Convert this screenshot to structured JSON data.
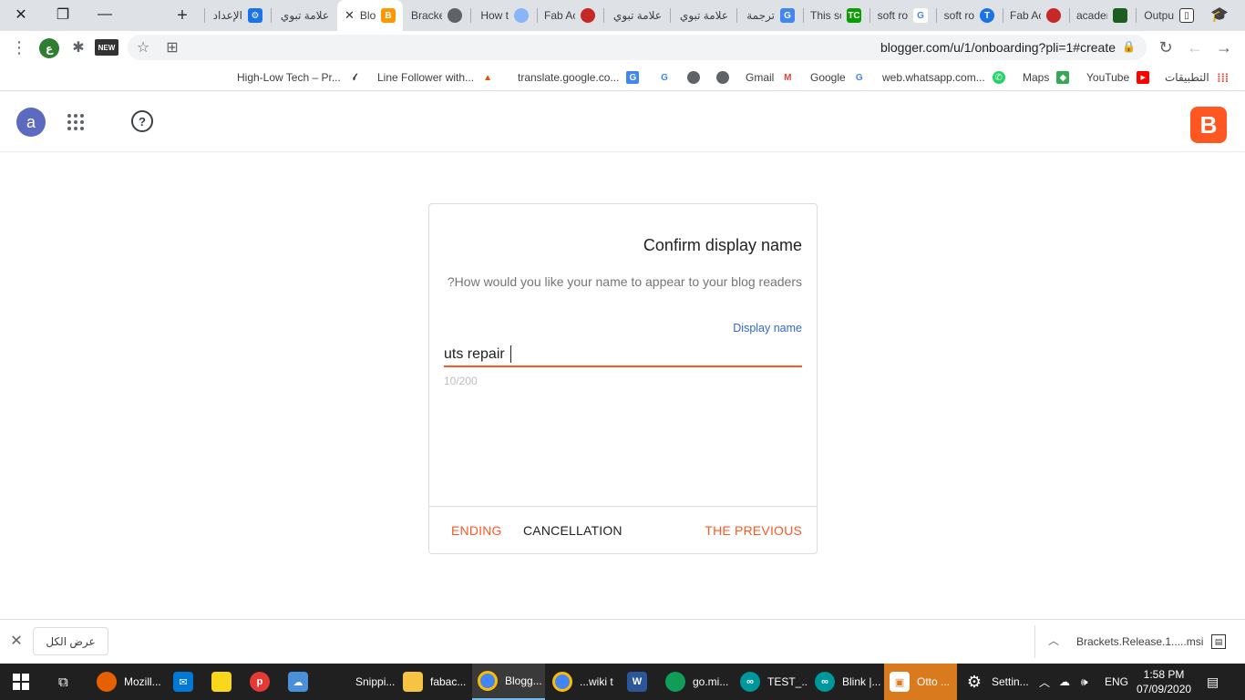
{
  "browser": {
    "tabs": [
      {
        "title": "الإعداد",
        "icon": "gear-icon"
      },
      {
        "title": "علامة تبوي",
        "icon": ""
      },
      {
        "title": "Blo",
        "icon": "blogger-icon",
        "active": true
      },
      {
        "title": "Bracke",
        "icon": "globe-icon"
      },
      {
        "title": "How t",
        "icon": "puzzle-icon"
      },
      {
        "title": "Fab Ac",
        "icon": "fab-icon"
      },
      {
        "title": "علامة تبوي",
        "icon": ""
      },
      {
        "title": "علامة تبوي",
        "icon": ""
      },
      {
        "title": "ترجمة",
        "icon": "translate-icon"
      },
      {
        "title": "This so",
        "icon": "techcrunch-icon"
      },
      {
        "title": "soft ro",
        "icon": "google-icon"
      },
      {
        "title": "soft ro",
        "icon": "translate-badge-icon"
      },
      {
        "title": "Fab Ac",
        "icon": "fab-icon"
      },
      {
        "title": "acaden",
        "icon": "academany-icon"
      },
      {
        "title": "Outpu",
        "icon": "book-icon"
      }
    ],
    "url": "blogger.com/u/1/onboarding?pli=1#create",
    "extension_letter": "ع",
    "new_badge": "NEW"
  },
  "bookmarks": [
    {
      "label": "High-Low Tech – Pr...",
      "icon": "highlow-icon"
    },
    {
      "label": "Line Follower with...",
      "icon": "matlab-icon"
    },
    {
      "label": "translate.google.co...",
      "icon": "translate-icon"
    },
    {
      "label": "",
      "icon": "google-icon"
    },
    {
      "label": "",
      "icon": "globe-icon"
    },
    {
      "label": "",
      "icon": "globe-icon"
    },
    {
      "label": "Gmail",
      "icon": "gmail-icon"
    },
    {
      "label": "Google",
      "icon": "google-icon"
    },
    {
      "label": "web.whatsapp.com...",
      "icon": "whatsapp-icon"
    },
    {
      "label": "Maps",
      "icon": "maps-icon"
    },
    {
      "label": "YouTube",
      "icon": "youtube-icon"
    },
    {
      "label": "التطبيقات",
      "icon": "apps-grid-icon"
    }
  ],
  "header": {
    "avatar_letter": "a",
    "help_glyph": "?",
    "logo_letter": "B"
  },
  "dialog": {
    "title": "Confirm display name",
    "subtitle": "?How would you like your name to appear to your blog readers",
    "field_label": "Display name",
    "field_value": "uts repair",
    "counter": "10/200",
    "buttons": {
      "ending": "ENDING",
      "cancel": "CANCELLATION",
      "previous": "THE PREVIOUS"
    },
    "colors": {
      "accent": "#ff5722",
      "label": "#3367d6"
    }
  },
  "downloads": {
    "show_all": "عرض الكل",
    "file_name": "Brackets.Release.1.....msi"
  },
  "taskbar": {
    "items": [
      {
        "label": "Mozill...",
        "icon": "firefox-icon"
      },
      {
        "label": "",
        "icon": "mail-icon"
      },
      {
        "label": "",
        "icon": "sticky-notes-icon"
      },
      {
        "label": "",
        "icon": "app-p-icon"
      },
      {
        "label": "",
        "icon": "cloud-icon"
      },
      {
        "label": "Snippi...",
        "icon": "snipping-icon"
      },
      {
        "label": "fabac...",
        "icon": "folder-icon"
      },
      {
        "label": "Blogg...",
        "icon": "chrome-icon"
      },
      {
        "label": "...wiki t",
        "icon": "chrome-icon"
      },
      {
        "label": "",
        "icon": "word-icon"
      },
      {
        "label": "go.mi...",
        "icon": "edge-icon"
      },
      {
        "label": "TEST_...",
        "icon": "arduino-icon"
      },
      {
        "label": "Blink |...",
        "icon": "arduino-icon"
      },
      {
        "label": "Otto ...",
        "icon": "otto-icon"
      },
      {
        "label": "Settin...",
        "icon": "settings-icon"
      }
    ],
    "language": "ENG",
    "time": "1:58 PM",
    "date": "07/09/2020"
  }
}
